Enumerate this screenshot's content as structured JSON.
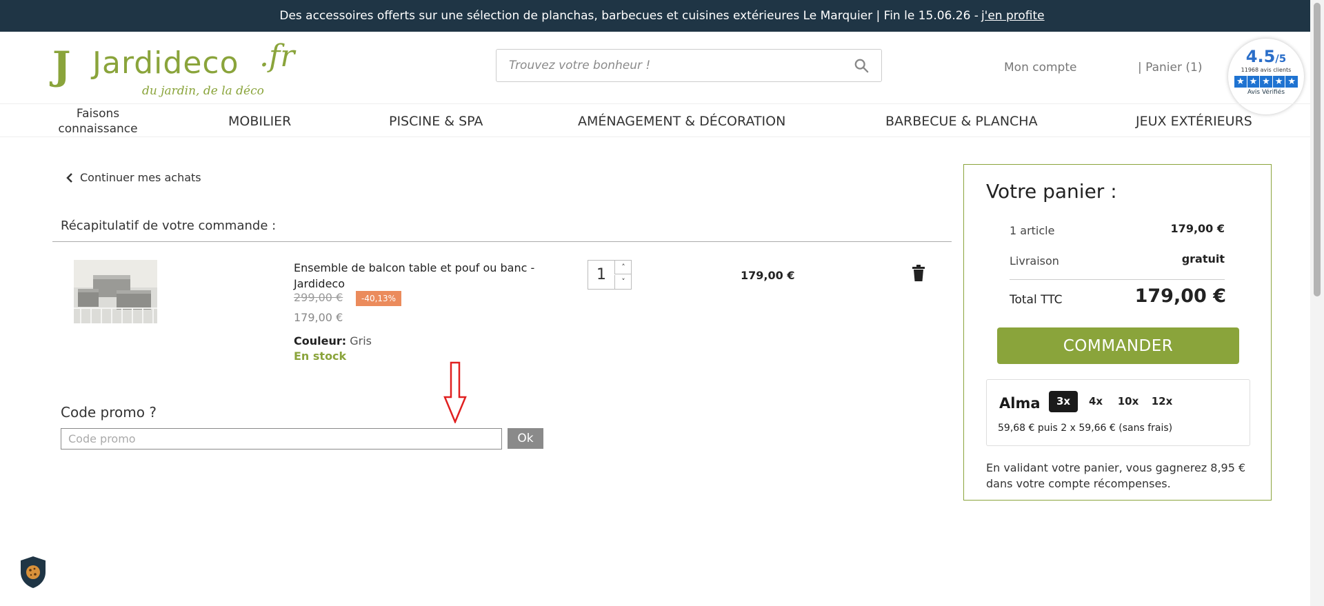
{
  "topbar": {
    "message": "Des accessoires offerts sur une sélection de planchas, barbecues et cuisines extérieures Le Marquier | Fin le 15.06.26 -",
    "link": "j'en profite"
  },
  "header": {
    "logo_main": "Jardideco",
    "logo_tld": ".fr",
    "logo_tagline": "du jardin, de la déco",
    "search_placeholder": "Trouvez votre bonheur !",
    "account": "Mon compte",
    "cart": "| Panier (1)"
  },
  "rating": {
    "score": "4.5",
    "scale": "/5",
    "count": "11968 avis clients",
    "brand": "Avis Vérifiés"
  },
  "nav": {
    "about": "Faisons connaissance",
    "items": [
      "MOBILIER",
      "PISCINE & SPA",
      "AMÉNAGEMENT & DÉCORATION",
      "BARBECUE & PLANCHA",
      "JEUX EXTÉRIEURS"
    ]
  },
  "cart": {
    "back": "Continuer mes achats",
    "recap_title": "Récapitulatif de votre commande :",
    "item": {
      "name": "Ensemble de balcon table et pouf ou banc - Jardideco",
      "old_price": "299,00 €",
      "discount": "-40,13%",
      "price": "179,00 €",
      "color_label": "Couleur:",
      "color_value": "Gris",
      "stock": "En stock",
      "quantity": "1",
      "line_total": "179,00 €"
    },
    "promo_title": "Code promo ?",
    "promo_placeholder": "Code promo",
    "promo_button": "Ok"
  },
  "summary": {
    "title": "Votre panier :",
    "articles_label": "1 article",
    "articles_value": "179,00 €",
    "shipping_label": "Livraison",
    "shipping_value": "gratuit",
    "total_label": "Total TTC",
    "total_value": "179,00 €",
    "order_button": "COMMANDER",
    "alma": {
      "logo": "Alma",
      "options": [
        "3x",
        "4x",
        "10x",
        "12x"
      ],
      "selected": "3x",
      "detail": "59,68 € puis 2 x 59,66 € (sans frais)"
    },
    "reward_text": "En validant votre panier, vous gagnerez 8,95 € dans votre compte récompenses."
  },
  "colors": {
    "brand_green": "#8aa43b",
    "topbar_bg": "#1f3545",
    "discount_badge": "#eb8b5c",
    "annotation_arrow": "#e02020"
  }
}
